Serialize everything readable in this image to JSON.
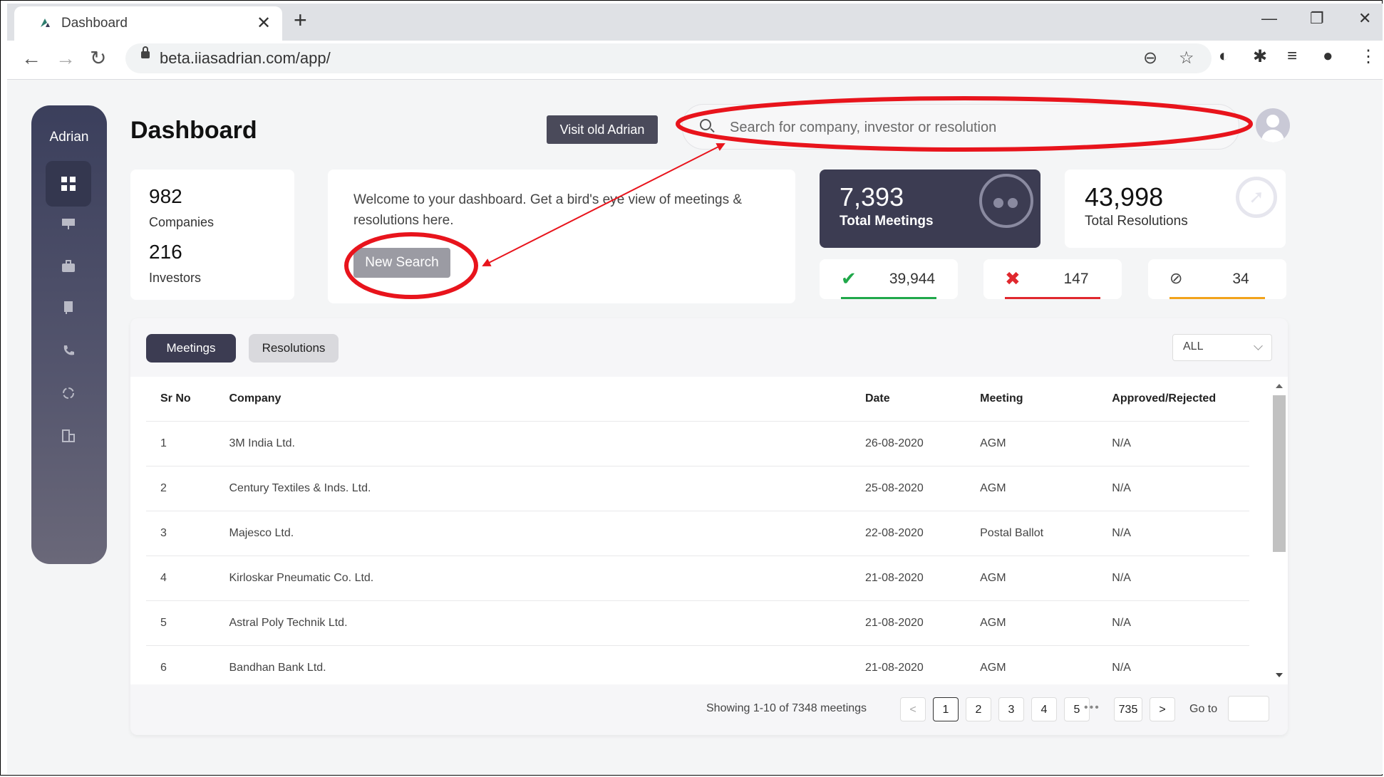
{
  "browser": {
    "tab_title": "Dashboard",
    "tab_close": "✕",
    "new_tab": "+",
    "url": "beta.iiasadrian.com/app/",
    "minimize": "—",
    "maximize": "❐",
    "close": "✕"
  },
  "sidebar": {
    "brand": "Adrian"
  },
  "header": {
    "title": "Dashboard",
    "visit_old": "Visit old Adrian",
    "search_placeholder": "Search for company, investor or resolution"
  },
  "counts": {
    "companies_value": "982",
    "companies_label": "Companies",
    "investors_value": "216",
    "investors_label": "Investors"
  },
  "welcome": {
    "text": "Welcome to your dashboard. Get a bird's eye view of meetings & resolutions here.",
    "button": "New Search"
  },
  "stats": {
    "meetings_value": "7,393",
    "meetings_label": "Total Meetings",
    "resolutions_value": "43,998",
    "resolutions_label": "Total Resolutions"
  },
  "mini_stats": {
    "approved": "39,944",
    "rejected": "147",
    "abstained": "34",
    "approved_color": "#20a84a",
    "rejected_color": "#e0282e",
    "abstained_color": "#f2a31b"
  },
  "tabs": {
    "meetings": "Meetings",
    "resolutions": "Resolutions"
  },
  "filter": {
    "value": "ALL"
  },
  "table": {
    "headers": [
      "Sr No",
      "Company",
      "Date",
      "Meeting",
      "Approved/Rejected"
    ],
    "rows": [
      [
        "1",
        "3M India Ltd.",
        "26-08-2020",
        "AGM",
        "N/A"
      ],
      [
        "2",
        "Century Textiles & Inds. Ltd.",
        "25-08-2020",
        "AGM",
        "N/A"
      ],
      [
        "3",
        "Majesco Ltd.",
        "22-08-2020",
        "Postal Ballot",
        "N/A"
      ],
      [
        "4",
        "Kirloskar Pneumatic Co. Ltd.",
        "21-08-2020",
        "AGM",
        "N/A"
      ],
      [
        "5",
        "Astral Poly Technik Ltd.",
        "21-08-2020",
        "AGM",
        "N/A"
      ],
      [
        "6",
        "Bandhan Bank Ltd.",
        "21-08-2020",
        "AGM",
        "N/A"
      ]
    ]
  },
  "pagination": {
    "showing": "Showing 1-10 of 7348 meetings",
    "prev": "<",
    "next": ">",
    "pages": [
      "1",
      "2",
      "3",
      "4",
      "5"
    ],
    "dots": "•••",
    "last": "735",
    "goto": "Go to"
  },
  "annotation_color": "#e8141c"
}
